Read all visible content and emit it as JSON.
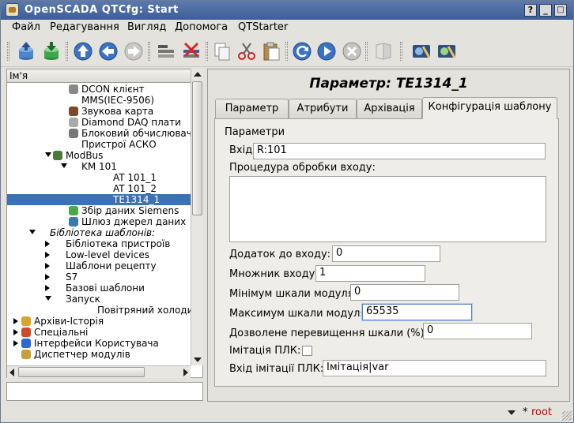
{
  "window": {
    "title": "OpenSCADA QTCfg: Start",
    "buttons": {
      "help": "?",
      "minimize": "_",
      "maximize": "□",
      "close": "×"
    }
  },
  "menu": [
    "Файл",
    "Редагування",
    "Вигляд",
    "Допомога",
    "QTStarter"
  ],
  "toolbar": [
    "db-load-icon",
    "db-save-icon",
    "up-icon",
    "back-icon",
    "forward-icon",
    "add-item-icon",
    "delete-item-icon",
    "copy-icon",
    "cut-icon",
    "paste-icon",
    "refresh-icon",
    "start-icon",
    "stop-icon",
    "manual-icon",
    "module-icon-1",
    "module-icon-2"
  ],
  "tree": {
    "header": "Ім'я",
    "rows": [
      {
        "label": "DCON клієнт",
        "indent": 5,
        "icon": "dcon"
      },
      {
        "label": "MMS(IEC-9506)",
        "indent": 5,
        "icon": ""
      },
      {
        "label": "Звукова карта",
        "indent": 5,
        "icon": "sound"
      },
      {
        "label": "Diamond DAQ плати",
        "indent": 5,
        "icon": "diamond"
      },
      {
        "label": "Блоковий обчислювач",
        "indent": 5,
        "icon": "block"
      },
      {
        "label": "Пристрої АСКО",
        "indent": 5,
        "icon": ""
      },
      {
        "label": "ModBus",
        "indent": 4,
        "icon": "modbus",
        "arrow": "down"
      },
      {
        "label": "KM 101",
        "indent": 5,
        "arrow": "down",
        "icon": ""
      },
      {
        "label": "AT 101_1",
        "indent": 7,
        "icon": ""
      },
      {
        "label": "AT 101_2",
        "indent": 7,
        "icon": ""
      },
      {
        "label": "TE1314_1",
        "indent": 7,
        "icon": "",
        "selected": true
      },
      {
        "label": "Збір даних Siemens",
        "indent": 5,
        "icon": "siemens"
      },
      {
        "label": "Шлюз джерел даних",
        "indent": 5,
        "icon": "gate"
      },
      {
        "label": "Бібліотека шаблонів:",
        "indent": 3,
        "arrow": "down",
        "italic": true,
        "icon": ""
      },
      {
        "label": "Бібліотека пристроїв",
        "indent": 4,
        "arrow": "right",
        "icon": ""
      },
      {
        "label": "Low-level devices",
        "indent": 4,
        "arrow": "right",
        "icon": ""
      },
      {
        "label": "Шаблони рецепту",
        "indent": 4,
        "arrow": "right",
        "icon": ""
      },
      {
        "label": "S7",
        "indent": 4,
        "arrow": "right",
        "icon": ""
      },
      {
        "label": "Базові шаблони",
        "indent": 4,
        "arrow": "right",
        "icon": ""
      },
      {
        "label": "Запуск",
        "indent": 4,
        "arrow": "down",
        "icon": ""
      },
      {
        "label": "Повітряний холодильник",
        "indent": 6,
        "icon": ""
      },
      {
        "label": "Архіви-Історія",
        "indent": 2,
        "arrow": "right",
        "icon": "archive"
      },
      {
        "label": "Спеціальні",
        "indent": 2,
        "arrow": "right",
        "icon": "special"
      },
      {
        "label": "Інтерфейси Користувача",
        "indent": 2,
        "arrow": "right",
        "icon": "ui"
      },
      {
        "label": "Диспетчер модулів",
        "indent": 2,
        "icon": "modules"
      }
    ]
  },
  "panel": {
    "title": "Параметр: TE1314_1",
    "tabs": [
      {
        "label": "Параметр",
        "active": false
      },
      {
        "label": "Атрибути",
        "active": false
      },
      {
        "label": "Архівація",
        "active": false
      },
      {
        "label": "Конфігурація шаблону",
        "active": true
      }
    ],
    "group_title": "Параметри",
    "fields": {
      "input_label": "Вхід:",
      "input_value": "R:101",
      "proc_label": "Процедура обробки входу:",
      "add_label": "Додаток до входу:",
      "add_value": "0",
      "mult_label": "Множник входу:",
      "mult_value": "1",
      "min_label": "Мінімум шкали модуля:",
      "min_value": "0",
      "max_label": "Максимум шкали модуля:",
      "max_value": "65535",
      "over_label": "Дозволене перевищення шкали (%):",
      "over_value": "0",
      "plc_label": "Імітація ПЛК:",
      "plc_checked": false,
      "plcin_label": "Вхід імітації ПЛК:",
      "plcin_value": "Імітація|var"
    }
  },
  "status": {
    "star": "*",
    "user": "root"
  }
}
